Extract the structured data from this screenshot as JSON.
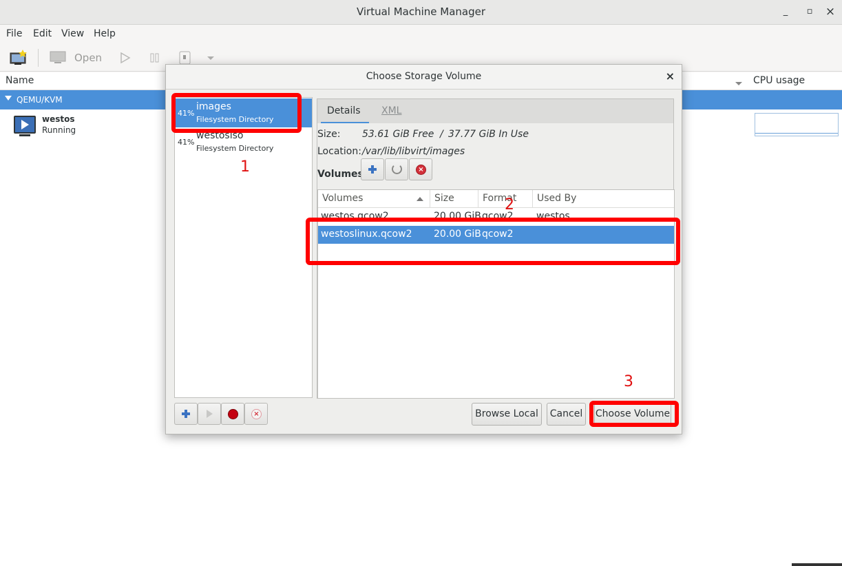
{
  "window": {
    "title": "Virtual Machine Manager",
    "minimize": "_",
    "maximize": "▫",
    "close": "×"
  },
  "menu": [
    "File",
    "Edit",
    "View",
    "Help"
  ],
  "toolbar": {
    "open_label": "Open"
  },
  "list": {
    "col_name": "Name",
    "col_cpu": "CPU usage",
    "connection": "QEMU/KVM",
    "vm_name": "westos",
    "vm_status": "Running"
  },
  "dialog": {
    "title": "Choose Storage Volume",
    "close": "×",
    "pools": [
      {
        "percent": "41%",
        "name": "images",
        "type": "Filesystem Directory"
      },
      {
        "percent": "41%",
        "name": "westosiso",
        "type": "Filesystem Directory"
      }
    ],
    "tabs": [
      "Details",
      "XML"
    ],
    "size_label": "Size:",
    "size_free": "53.61 GiB Free",
    "size_sep": "/",
    "size_used": "37.77 GiB In Use",
    "location_label": "Location:",
    "location_value": "/var/lib/libvirt/images",
    "volumes_label": "Volumes",
    "columns": [
      "Volumes",
      "Size",
      "Format",
      "Used By"
    ],
    "rows": [
      {
        "name": "westos.qcow2",
        "size": "20.00 GiB",
        "format": "qcow2",
        "used_by": "westos"
      },
      {
        "name": "westoslinux.qcow2",
        "size": "20.00 GiB",
        "format": "qcow2",
        "used_by": ""
      }
    ],
    "browse_local": "Browse Local",
    "cancel": "Cancel",
    "choose_volume": "Choose Volume"
  },
  "annotations": [
    "1",
    "2",
    "3"
  ],
  "colors": {
    "selection": "#4a90d9",
    "annotation": "#ff0000"
  }
}
